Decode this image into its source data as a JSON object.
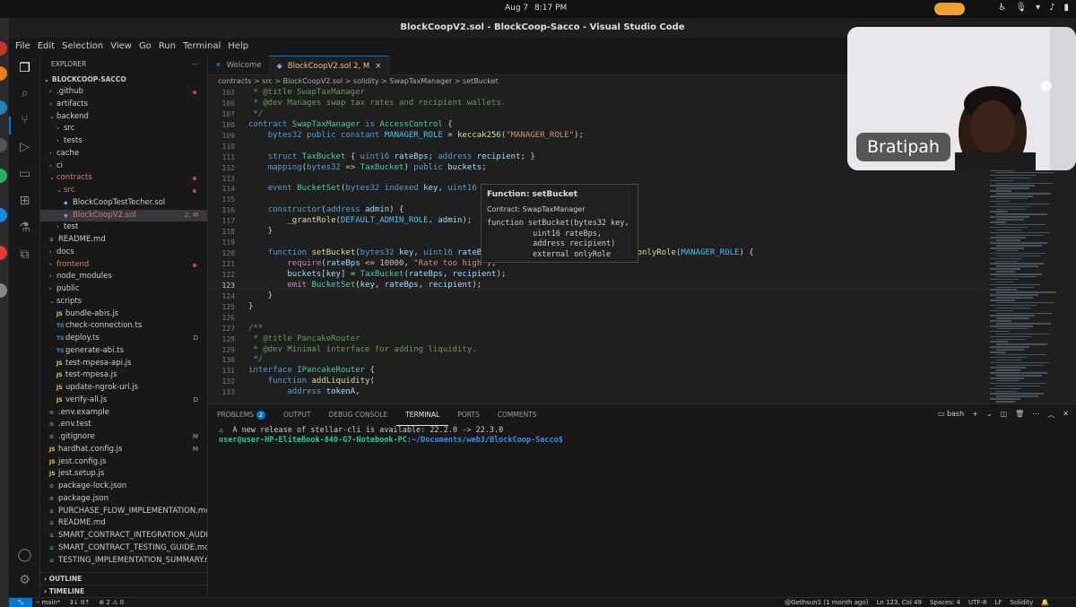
{
  "system": {
    "date": "Aug 7",
    "time": "8:17 PM"
  },
  "window_title": "BlockCoopV2.sol - BlockCoop-Sacco - Visual Studio Code",
  "menu": [
    "File",
    "Edit",
    "Selection",
    "View",
    "Go",
    "Run",
    "Terminal",
    "Help"
  ],
  "explorer": {
    "title": "EXPLORER",
    "root": "BLOCKCOOP-SACCO",
    "items": [
      {
        "label": ".github",
        "kind": "folder",
        "indent": 0,
        "open": false,
        "dot": true
      },
      {
        "label": "artifacts",
        "kind": "folder",
        "indent": 0,
        "open": false
      },
      {
        "label": "backend",
        "kind": "folder",
        "indent": 0,
        "open": true
      },
      {
        "label": "src",
        "kind": "folder",
        "indent": 1,
        "open": false
      },
      {
        "label": "tests",
        "kind": "folder",
        "indent": 1,
        "open": false
      },
      {
        "label": "cache",
        "kind": "folder",
        "indent": 0,
        "open": false
      },
      {
        "label": "ci",
        "kind": "folder",
        "indent": 0,
        "open": false
      },
      {
        "label": "contracts",
        "kind": "folder",
        "indent": 0,
        "open": true,
        "red": true,
        "dot": true
      },
      {
        "label": "src",
        "kind": "folder",
        "indent": 1,
        "open": true,
        "red": true,
        "dot": true
      },
      {
        "label": "BlockCoopTestTecher.sol",
        "kind": "file",
        "ext": "sol",
        "indent": 2
      },
      {
        "label": "BlockCoopV2.sol",
        "kind": "file",
        "ext": "sol",
        "indent": 2,
        "red": true,
        "selected": true,
        "badge": "2, M"
      },
      {
        "label": "test",
        "kind": "folder",
        "indent": 1,
        "open": false
      },
      {
        "label": "README.md",
        "kind": "file",
        "ext": "md",
        "indent": 0
      },
      {
        "label": "docs",
        "kind": "folder",
        "indent": 0,
        "open": false
      },
      {
        "label": "frontend",
        "kind": "folder",
        "indent": 0,
        "open": false,
        "red": true,
        "dot": true
      },
      {
        "label": "node_modules",
        "kind": "folder",
        "indent": 0,
        "open": false
      },
      {
        "label": "public",
        "kind": "folder",
        "indent": 0,
        "open": false
      },
      {
        "label": "scripts",
        "kind": "folder",
        "indent": 0,
        "open": true
      },
      {
        "label": "bundle-abis.js",
        "kind": "file",
        "ext": "js",
        "indent": 1
      },
      {
        "label": "check-connection.ts",
        "kind": "file",
        "ext": "ts",
        "indent": 1
      },
      {
        "label": "deploy.ts",
        "kind": "file",
        "ext": "ts",
        "indent": 1,
        "badge": "D"
      },
      {
        "label": "generate-abi.ts",
        "kind": "file",
        "ext": "ts",
        "indent": 1
      },
      {
        "label": "test-mpesa-api.js",
        "kind": "file",
        "ext": "js",
        "indent": 1
      },
      {
        "label": "test-mpesa.js",
        "kind": "file",
        "ext": "js",
        "indent": 1
      },
      {
        "label": "update-ngrok-url.js",
        "kind": "file",
        "ext": "js",
        "indent": 1
      },
      {
        "label": "verify-all.js",
        "kind": "file",
        "ext": "js",
        "indent": 1,
        "badge": "D"
      },
      {
        "label": ".env.example",
        "kind": "file",
        "ext": "cfg",
        "indent": 0
      },
      {
        "label": ".env.test",
        "kind": "file",
        "ext": "cfg",
        "indent": 0
      },
      {
        "label": ".gitignore",
        "kind": "file",
        "ext": "cfg",
        "indent": 0,
        "badge": "M"
      },
      {
        "label": "hardhat.config.js",
        "kind": "file",
        "ext": "js",
        "indent": 0,
        "badge": "M"
      },
      {
        "label": "jest.config.js",
        "kind": "file",
        "ext": "js",
        "indent": 0
      },
      {
        "label": "jest.setup.js",
        "kind": "file",
        "ext": "js",
        "indent": 0
      },
      {
        "label": "package-lock.json",
        "kind": "file",
        "ext": "cfg",
        "indent": 0
      },
      {
        "label": "package.json",
        "kind": "file",
        "ext": "cfg",
        "indent": 0
      },
      {
        "label": "PURCHASE_FLOW_IMPLEMENTATION.md",
        "kind": "file",
        "ext": "md",
        "indent": 0
      },
      {
        "label": "README.md",
        "kind": "file",
        "ext": "md",
        "indent": 0
      },
      {
        "label": "SMART_CONTRACT_INTEGRATION_AUDIT...",
        "kind": "file",
        "ext": "md",
        "indent": 0
      },
      {
        "label": "SMART_CONTRACT_TESTING_GUIDE.md",
        "kind": "file",
        "ext": "md",
        "indent": 0
      },
      {
        "label": "TESTING_IMPLEMENTATION_SUMMARY.md",
        "kind": "file",
        "ext": "md",
        "indent": 0
      }
    ],
    "outline": "OUTLINE",
    "timeline": "TIMELINE"
  },
  "tabs": [
    {
      "label": "Welcome",
      "active": false,
      "icon": "vscode-icon"
    },
    {
      "label": "BlockCoopV2.sol 2, M",
      "active": true,
      "icon": "solidity-icon"
    }
  ],
  "breadcrumb": "contracts > src > BlockCoopV2.sol > solidity > SwapTaxManager > setBucket",
  "code_lines": [
    {
      "n": "103",
      "html": "<span class='c'> * @title SwapTaxManager</span>"
    },
    {
      "n": "106",
      "html": "<span class='c'> * @dev Manages swap tax rates and recipient wallets.</span>"
    },
    {
      "n": "107",
      "html": "<span class='c'> */</span>"
    },
    {
      "n": "108",
      "html": "<span class='k'>contract</span> <span class='t'>SwapTaxManager</span> <span class='k'>is</span> <span class='t'>AccessControl</span> {"
    },
    {
      "n": "109",
      "html": "    <span class='k'>bytes32</span> <span class='k'>public</span> <span class='k'>constant</span> <span class='cst'>MANAGER_ROLE</span> = <span class='f'>keccak256</span>(<span class='s'>\"MANAGER_ROLE\"</span>);"
    },
    {
      "n": "110",
      "html": ""
    },
    {
      "n": "111",
      "html": "    <span class='k'>struct</span> <span class='t'>TaxBucket</span> { <span class='k'>uint16</span> <span class='v'>rateBps</span>; <span class='k'>address</span> <span class='v'>recipient</span>; }"
    },
    {
      "n": "112",
      "html": "    <span class='k'>mapping</span>(<span class='k'>bytes32</span> => <span class='t'>TaxBucket</span>) <span class='k'>public</span> <span class='v'>buckets</span>;"
    },
    {
      "n": "113",
      "html": ""
    },
    {
      "n": "114",
      "html": "    <span class='k'>event</span> <span class='t'>BucketSet</span>(<span class='k'>bytes32</span> <span class='k'>indexed</span> <span class='v'>key</span>, <span class='k'>uint16</span> <span class='v'>rateBps</span>, <span class='k'>address</span> <span class='v'>recipient</span>);"
    },
    {
      "n": "115",
      "html": ""
    },
    {
      "n": "116",
      "html": "    <span class='k'>constructor</span>(<span class='k'>address</span> <span class='v'>admin</span>) {"
    },
    {
      "n": "117",
      "html": "        <span class='f'>_grantRole</span>(<span class='cst'>DEFAULT_ADMIN_ROLE</span>, <span class='v'>admin</span>);"
    },
    {
      "n": "118",
      "html": "    }"
    },
    {
      "n": "119",
      "html": ""
    },
    {
      "n": "120",
      "html": "    <span class='k'>function</span> <span class='f'>setBucket</span>(<span class='k'>bytes32</span> <span class='v'>key</span>, <span class='k'>uint16</span> <span class='v'>rateBps</span>, <span class='k'>address</span> <span class='v'>recipient</span>) <span class='k'>external</span> <span class='f'>onlyRole</span>(<span class='cst'>MANAGER_ROLE</span>) {"
    },
    {
      "n": "121",
      "html": "        <span class='p'>require</span>(<span class='v'>rateBps</span> <= <span class='n'>10000</span>, <span class='s'>\"Rate too high\"</span>);"
    },
    {
      "n": "122",
      "html": "        <span class='v'>buckets</span>[<span class='v'>key</span>] = <span class='t'>TaxBucket</span>(<span class='v'>rateBps</span>, <span class='v'>recipient</span>);"
    },
    {
      "n": "123",
      "html": "        <span class='p'>emit</span> <span class='t'>BucketSet</span>(<span class='v'>key</span>, <span class='v'>rateBps</span>, <span class='v'>recipient</span>);",
      "current": true
    },
    {
      "n": "124",
      "html": "    }"
    },
    {
      "n": "125",
      "html": "}"
    },
    {
      "n": "126",
      "html": ""
    },
    {
      "n": "127",
      "html": "<span class='c'>/**</span>"
    },
    {
      "n": "128",
      "html": "<span class='c'> * @title PancakeRouter</span>"
    },
    {
      "n": "129",
      "html": "<span class='c'> * @dev Minimal interface for adding liquidity.</span>"
    },
    {
      "n": "130",
      "html": "<span class='c'> */</span>"
    },
    {
      "n": "131",
      "html": "<span class='k'>interface</span> <span class='t'>IPancakeRouter</span> {"
    },
    {
      "n": "132",
      "html": "    <span class='k'>function</span> <span class='f'>addLiquidity</span>("
    },
    {
      "n": "133",
      "html": "        <span class='k'>address</span> <span class='v'>tokenA</span>,"
    }
  ],
  "hover": {
    "title": "Function: setBucket",
    "contract": "Contract: SwapTaxManager",
    "signature": "function setBucket(bytes32 key,\n          uint16 rateBps,\n          address recipient)\n          external onlyRole"
  },
  "panel": {
    "tabs": [
      {
        "label": "PROBLEMS",
        "count": "2"
      },
      {
        "label": "OUTPUT"
      },
      {
        "label": "DEBUG CONSOLE"
      },
      {
        "label": "TERMINAL",
        "active": true
      },
      {
        "label": "PORTS"
      },
      {
        "label": "COMMENTS"
      }
    ],
    "shell": "bash",
    "terminal_warning": "⚠  A new release of stellar-cli is available: 22.2.0 -> 22.3.0",
    "prompt_user": "user@user-HP-EliteBook-840-G7-Notebook-PC",
    "prompt_path": ":~/Documents/web3/BlockCoop-Sacco$"
  },
  "status": {
    "branch": "main*",
    "sync": "3↓ 0↑",
    "problems": "⊗ 2 ⚠ 0",
    "blame": "@Gethsun1 (1 month ago)",
    "cursor": "Ln 123, Col 49",
    "spaces": "Spaces: 4",
    "encoding": "UTF-8",
    "eol": "LF",
    "language": "Solidity"
  },
  "webcam": {
    "name": "Bratipah"
  },
  "colors": {
    "accent": "#0078d4",
    "modified": "#e2c08d",
    "editor_bg": "#1f1f1f",
    "sidebar_bg": "#181818"
  }
}
